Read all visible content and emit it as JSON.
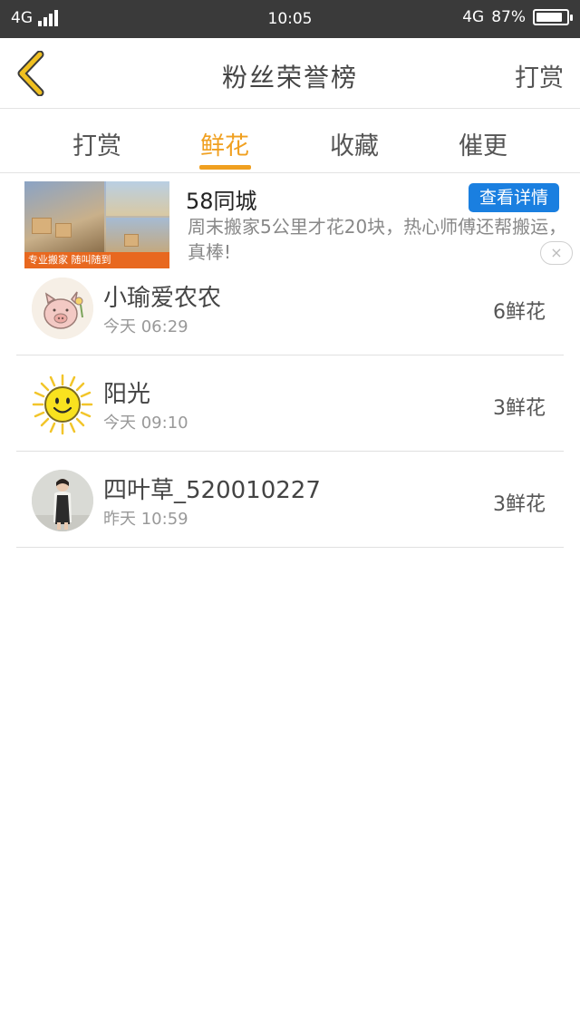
{
  "status_bar": {
    "network_left": "4G",
    "time": "10:05",
    "network_right": "4G",
    "battery": "87%",
    "battery_level": 0.87
  },
  "header": {
    "title": "粉丝荣誉榜",
    "action_label": "打赏"
  },
  "tabs": [
    {
      "label": "打赏",
      "active": false
    },
    {
      "label": "鲜花",
      "active": true
    },
    {
      "label": "收藏",
      "active": false
    },
    {
      "label": "催更",
      "active": false
    }
  ],
  "ad": {
    "title": "58同城",
    "description": "周末搬家5公里才花20块，热心师傅还帮搬运，真棒!",
    "button_label": "查看详情",
    "image_banner": "专业搬家 随叫随到",
    "close_symbol": "×"
  },
  "fans": [
    {
      "name": "小瑜爱农农",
      "time": "今天 06:29",
      "count": "6鲜花",
      "avatar": "pig-avatar"
    },
    {
      "name": "阳光",
      "time": "今天 09:10",
      "count": "3鲜花",
      "avatar": "sun-avatar"
    },
    {
      "name": "四叶草_520010227",
      "time": "昨天 10:59",
      "count": "3鲜花",
      "avatar": "girl-photo-avatar"
    }
  ],
  "colors": {
    "accent": "#f0a020",
    "ad_button": "#1a7fe0",
    "status_bar": "#3a3a3a",
    "back_icon": "#f0c020"
  }
}
